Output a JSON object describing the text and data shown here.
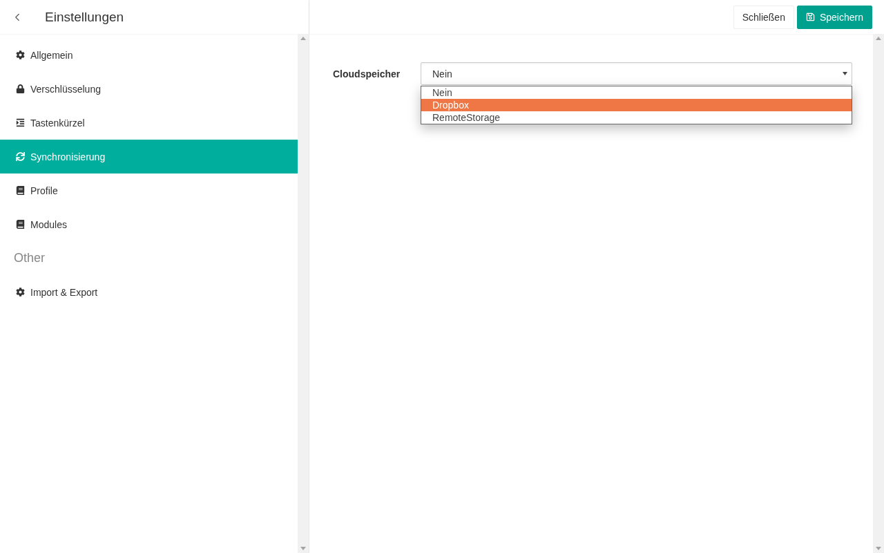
{
  "sidebar": {
    "title": "Einstellungen",
    "groups": [
      {
        "items": [
          {
            "label": "Allgemein",
            "selected": false
          },
          {
            "label": "Verschlüsselung",
            "selected": false
          },
          {
            "label": "Tastenkürzel",
            "selected": false
          },
          {
            "label": "Synchronisierung",
            "selected": true
          },
          {
            "label": "Profile",
            "selected": false
          },
          {
            "label": "Modules",
            "selected": false
          }
        ]
      },
      {
        "heading": "Other",
        "items": [
          {
            "label": "Import & Export",
            "selected": false
          }
        ]
      }
    ]
  },
  "toolbar": {
    "buttons": [
      {
        "label": "Schließen",
        "kind": "plain"
      },
      {
        "label": "Speichern",
        "kind": "primary"
      }
    ]
  },
  "form": {
    "label": "Cloudspeicher",
    "value": "Nein",
    "expanded": true,
    "options": [
      {
        "label": "Nein",
        "highlighted": false
      },
      {
        "label": "Dropbox",
        "highlighted": true
      },
      {
        "label": "RemoteStorage",
        "highlighted": false
      }
    ]
  }
}
